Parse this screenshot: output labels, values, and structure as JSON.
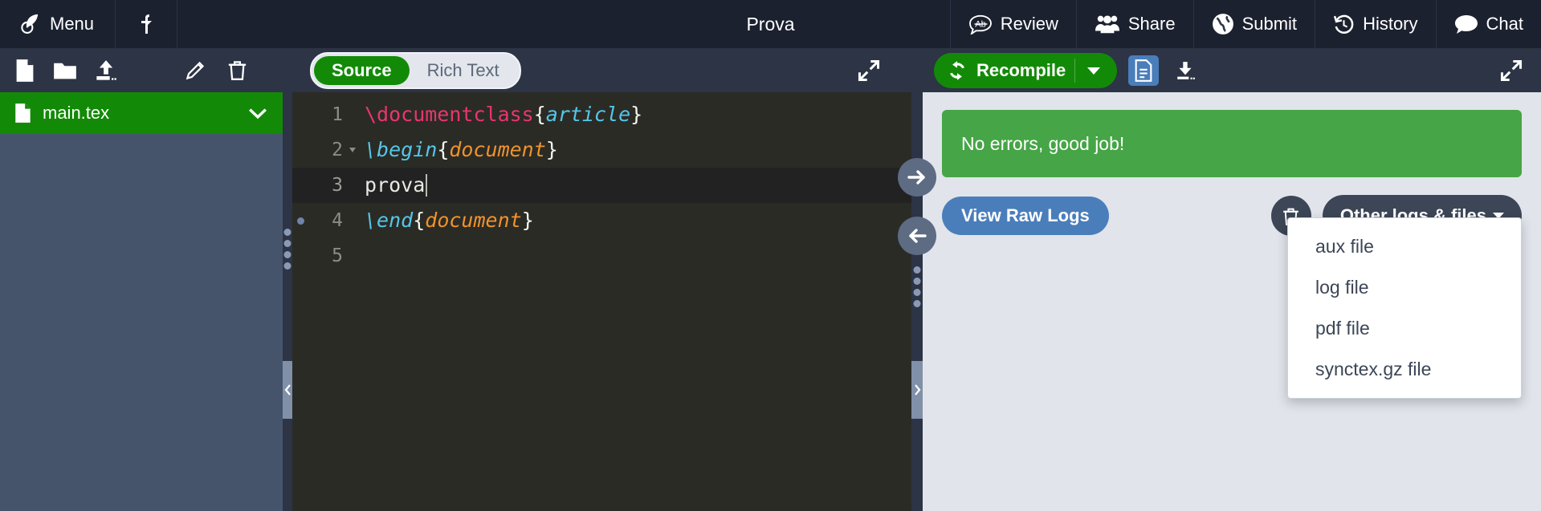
{
  "topnav": {
    "menu_label": "Menu",
    "upload_icon": "upload-arrow-icon",
    "project_title": "Prova",
    "right_items": [
      {
        "label": "Review",
        "icon": "review-ab-bubble-icon"
      },
      {
        "label": "Share",
        "icon": "share-people-icon"
      },
      {
        "label": "Submit",
        "icon": "submit-globe-icon"
      },
      {
        "label": "History",
        "icon": "history-clock-icon"
      },
      {
        "label": "Chat",
        "icon": "chat-bubble-icon"
      }
    ]
  },
  "filepane": {
    "toolbar": {
      "new_file": "new-file-icon",
      "new_folder": "new-folder-icon",
      "upload": "upload-file-icon",
      "rename": "pencil-rename-icon",
      "delete": "trash-delete-icon"
    },
    "files": [
      {
        "name": "main.tex",
        "icon": "file-icon",
        "selected": true
      }
    ]
  },
  "editor": {
    "mode_toggle": {
      "source_label": "Source",
      "rich_text_label": "Rich Text",
      "active": "Source"
    },
    "expand_icon": "expand-arrows-icon",
    "lines": [
      {
        "number": "1",
        "fold": false,
        "marker": false,
        "active": false
      },
      {
        "number": "2",
        "fold": true,
        "marker": false,
        "active": false
      },
      {
        "number": "3",
        "fold": false,
        "marker": false,
        "active": true
      },
      {
        "number": "4",
        "fold": false,
        "marker": true,
        "active": false
      },
      {
        "number": "5",
        "fold": false,
        "marker": false,
        "active": false
      }
    ],
    "code": {
      "l1_cmd": "\\documentclass",
      "l1_open": "{",
      "l1_arg": "article",
      "l1_close": "}",
      "l2_cmd": "\\begin",
      "l2_open": "{",
      "l2_arg": "document",
      "l2_close": "}",
      "l3_text": "prova",
      "l4_cmd": "\\end",
      "l4_open": "{",
      "l4_arg": "document",
      "l4_close": "}"
    }
  },
  "splitters": {
    "sync_to_pdf_icon": "arrow-right-icon",
    "sync_to_code_icon": "arrow-left-icon",
    "collapse_left_icon": "chevron-left-icon",
    "collapse_right_icon": "chevron-right-icon"
  },
  "pdfpane": {
    "toolbar": {
      "recompile_label": "Recompile",
      "recompile_icon": "refresh-icon",
      "recompile_caret": "chevron-down-icon",
      "pdf_view_icon": "document-pdf-icon",
      "download_icon": "download-icon",
      "expand_icon": "expand-arrows-icon"
    },
    "banner": {
      "message": "No errors, good job!"
    },
    "actions": {
      "view_raw_logs_label": "View Raw Logs",
      "clear_cache_icon": "trash-icon",
      "other_logs_label": "Other logs & files"
    },
    "dropdown": {
      "open": true,
      "items": [
        {
          "label": "aux file"
        },
        {
          "label": "log file"
        },
        {
          "label": "pdf file"
        },
        {
          "label": "synctex.gz file"
        }
      ]
    }
  },
  "colors": {
    "nav_bg": "#1c2130",
    "toolbar_bg": "#2c3445",
    "green": "#138a07",
    "banner_green": "#46a546",
    "blue": "#4a7ebb",
    "dark_btn": "#3c4656",
    "editor_bg": "#2b2b26",
    "pdf_bg": "#e1e4eb"
  }
}
